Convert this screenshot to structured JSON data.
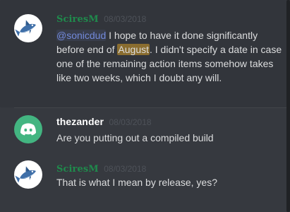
{
  "messages": [
    {
      "username": "SciresM",
      "timestamp": "08/03/2018",
      "avatar_icon": "shark-icon",
      "mention": "@sonicdud",
      "text_before_highlight": " I hope to have it done significantly before end of ",
      "highlight": "August",
      "text_after_highlight": ". I didn't specify a date in case one of the remaining action items somehow takes like two weeks, which I doubt any will."
    },
    {
      "username": "thezander",
      "timestamp": "08/03/2018",
      "avatar_icon": "discord-logo-icon",
      "text": "Are you putting out a compiled build"
    },
    {
      "username": "SciresM",
      "timestamp": "08/03/2018",
      "avatar_icon": "shark-icon",
      "text": "That is what I mean by release, yes?"
    }
  ],
  "colors": {
    "background": "#36393f",
    "sciresm_name": "#1f8b4c",
    "mention": "#7289da",
    "search_highlight": "#8a6d2f",
    "avatar_green": "#43b581"
  }
}
